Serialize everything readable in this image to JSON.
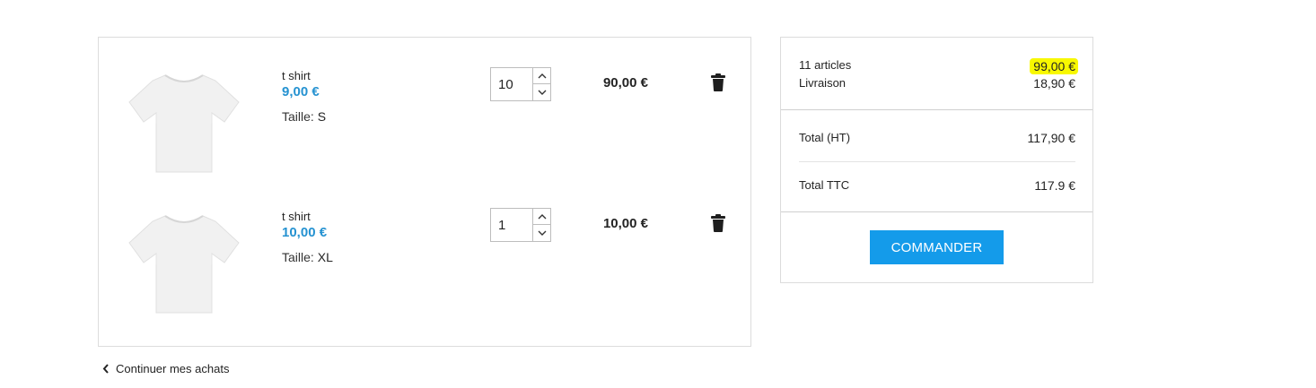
{
  "cart": {
    "items": [
      {
        "name": "t shirt",
        "unit_price": "9,00 €",
        "attribute_label": "Taille:",
        "attribute_value": "S",
        "quantity": "10",
        "line_total": "90,00 €",
        "image_icon": "tshirt-icon"
      },
      {
        "name": "t shirt",
        "unit_price": "10,00 €",
        "attribute_label": "Taille:",
        "attribute_value": "XL",
        "quantity": "1",
        "line_total": "10,00 €",
        "image_icon": "tshirt-icon"
      }
    ],
    "continue_label": "Continuer mes achats"
  },
  "summary": {
    "articles_label": "11 articles",
    "articles_value": "99,00 €",
    "shipping_label": "Livraison",
    "shipping_value": "18,90 €",
    "total_ht_label": "Total (HT)",
    "total_ht_value": "117,90 €",
    "total_ttc_label": "Total TTC",
    "total_ttc_value": "117.9 €",
    "order_button_label": "COMMANDER"
  },
  "colors": {
    "price_blue": "#2592d1",
    "button_blue": "#149bea",
    "highlight_yellow": "#f8f800"
  }
}
